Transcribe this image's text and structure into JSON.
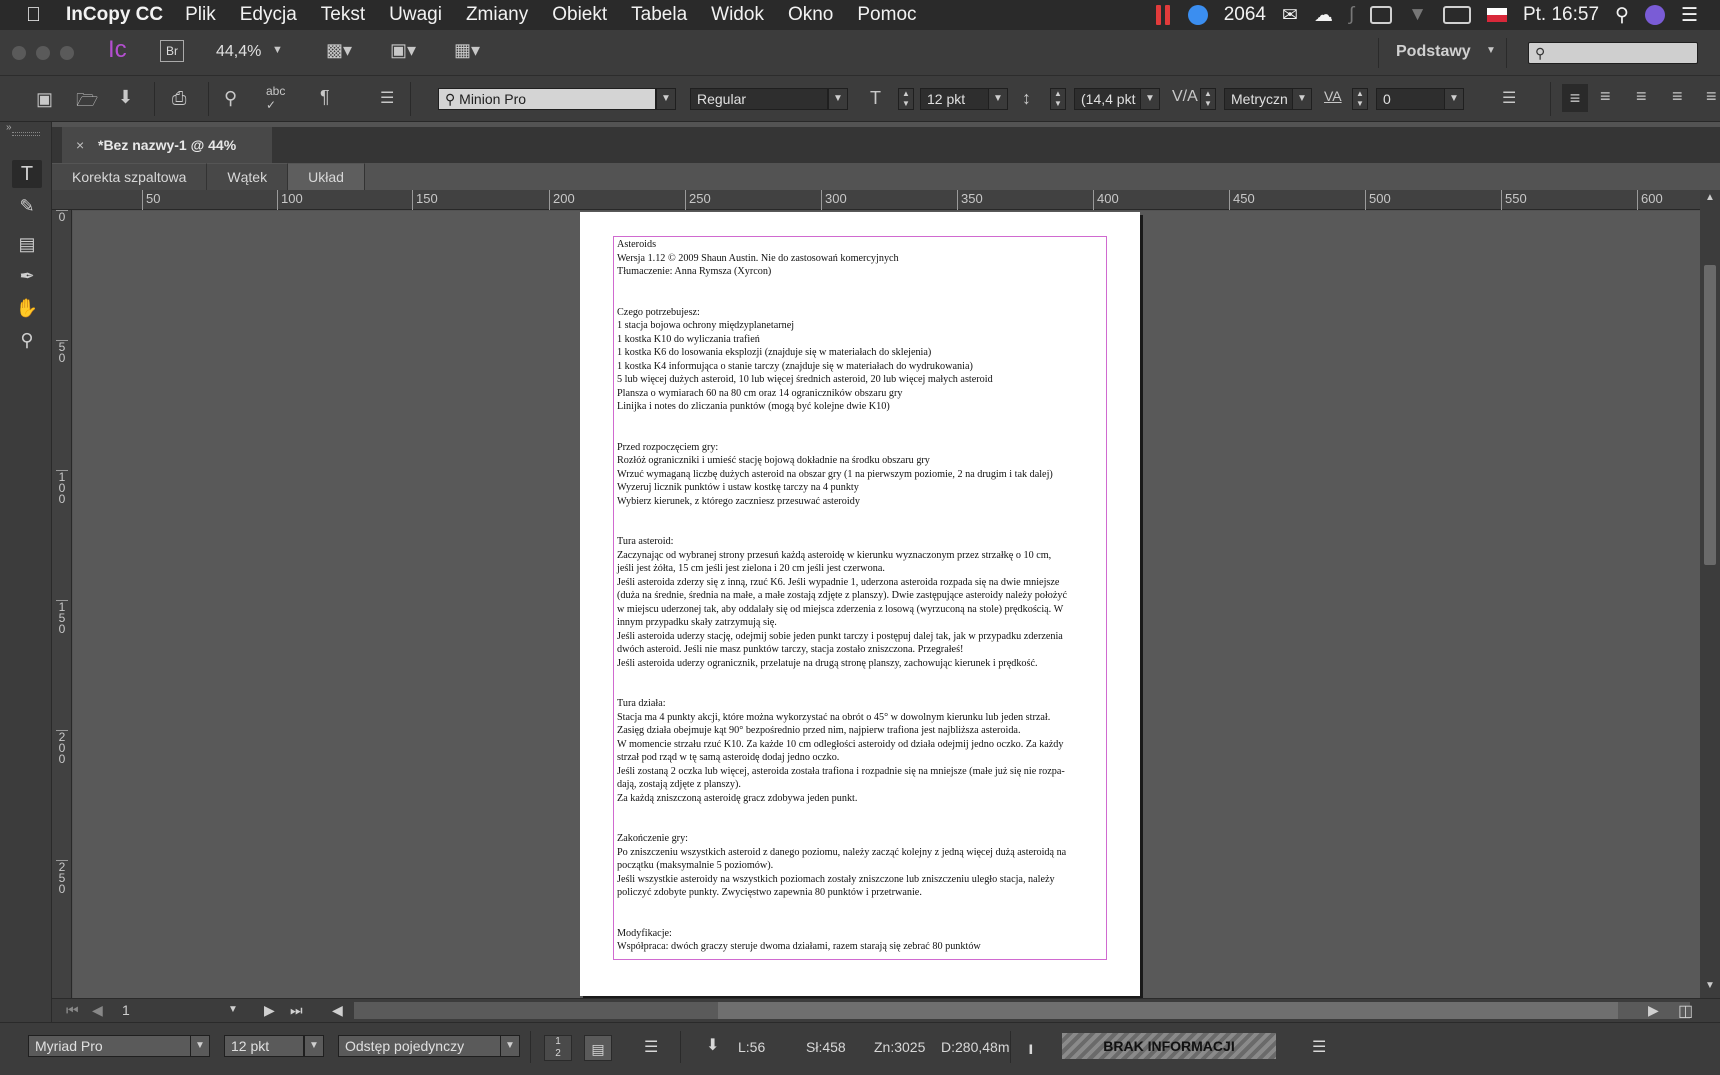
{
  "menubar": {
    "apple": "",
    "app": "InCopy CC",
    "items": [
      "Plik",
      "Edycja",
      "Tekst",
      "Uwagi",
      "Zmiany",
      "Obiekt",
      "Tabela",
      "Widok",
      "Okno",
      "Pomoc"
    ],
    "counter": "2064",
    "clock": "Pt. 16:57"
  },
  "appbar": {
    "app_icon": "Ic",
    "bridge": "Br",
    "zoom": "44,4%",
    "workspace": "Podstawy",
    "search_placeholder": ""
  },
  "toolbar": {
    "font_family": "Minion Pro",
    "font_style": "Regular",
    "font_size": "12 pkt",
    "leading": "(14,4 pkt",
    "kerning": "Metryczn",
    "tracking": "0"
  },
  "tab": {
    "close": "×",
    "title": "*Bez nazwy-1 @ 44%"
  },
  "view_tabs": [
    "Korekta szpaltowa",
    "Wątek",
    "Układ"
  ],
  "ruler": {
    "h": [
      "50",
      "100",
      "150",
      "200",
      "250",
      "300",
      "350",
      "400",
      "450",
      "500",
      "550",
      "600"
    ],
    "v": [
      "0",
      "50",
      "100",
      "150",
      "200",
      "250"
    ]
  },
  "story": {
    "blocks": [
      [
        "Asteroids",
        "Wersja 1.12 © 2009 Shaun Austin. Nie do zastosowań komercyjnych",
        "Tłumaczenie: Anna Rymsza (Xyrcon)"
      ],
      [
        "Czego potrzebujesz:",
        "1 stacja bojowa ochrony międzyplanetarnej",
        "1 kostka K10 do wyliczania trafień",
        "1 kostka K6 do losowania eksplozji (znajduje się w materiałach do sklejenia)",
        "1 kostka K4 informująca o stanie tarczy (znajduje się w materiałach do wydrukowania)",
        "5 lub więcej dużych asteroid, 10 lub więcej średnich asteroid, 20 lub więcej małych asteroid",
        "Plansza o wymiarach 60 na 80 cm oraz 14 ograniczników obszaru gry",
        "Linijka i notes do zliczania punktów (mogą być kolejne dwie K10)"
      ],
      [
        "Przed rozpoczęciem gry:",
        "Rozłóż ograniczniki i umieść stację bojową dokładnie na środku obszaru gry",
        "Wrzuć wymaganą liczbę dużych asteroid na obszar gry (1 na pierwszym poziomie, 2 na drugim i tak dalej)",
        "Wyzeruj licznik punktów i ustaw kostkę tarczy na 4 punkty",
        "Wybierz kierunek, z którego zaczniesz przesuwać asteroidy"
      ],
      [
        "Tura asteroid:",
        "Zaczynając od wybranej strony przesuń każdą asteroidę w kierunku wyznaczonym przez strzałkę o 10 cm,",
        "jeśli jest żółta, 15 cm jeśli jest zielona i 20 cm jeśli jest czerwona.",
        "Jeśli asteroida zderzy się z inną, rzuć K6. Jeśli wypadnie 1, uderzona asteroida rozpada się na dwie mniejsze",
        "(duża na średnie, średnia na małe, a małe zostają zdjęte z planszy). Dwie zastępujące asteroidy należy położyć",
        "w miejscu uderzonej tak, aby oddalały się od miejsca zderzenia z losową (wyrzuconą na stole) prędkością. W",
        "innym przypadku skały zatrzymują się.",
        "Jeśli asteroida uderzy stację, odejmij sobie jeden punkt tarczy i postępuj dalej tak, jak w przypadku zderzenia",
        "dwóch asteroid. Jeśli nie masz punktów tarczy, stacja zostało zniszczona. Przegrałeś!",
        "Jeśli asteroida uderzy ogranicznik, przelatuje na drugą stronę planszy, zachowując kierunek i prędkość."
      ],
      [
        "Tura działa:",
        "Stacja ma 4 punkty akcji, które można wykorzystać na obrót o 45° w dowolnym kierunku lub jeden strzał.",
        "Zasięg działa obejmuje kąt 90° bezpośrednio przed nim, najpierw trafiona jest najbliższa asteroida.",
        "W momencie strzału rzuć K10. Za każde 10 cm odległości asteroidy od działa odejmij jedno oczko. Za każdy",
        "strzał pod rząd w tę samą asteroidę dodaj jedno oczko.",
        "Jeśli zostaną 2 oczka lub więcej, asteroida została trafiona i rozpadnie się na mniejsze (małe już się nie rozpa-",
        "dają, zostają zdjęte z planszy).",
        "Za każdą zniszczoną asteroidę gracz zdobywa jeden punkt."
      ],
      [
        "Zakończenie gry:",
        "Po zniszczeniu wszystkich asteroid z danego poziomu, należy zacząć kolejny z jedną więcej dużą asteroidą na",
        "początku (maksymalnie 5 poziomów).",
        "Jeśli wszystkie asteroidy na wszystkich poziomach zostały zniszczone lub zniszczeniu uległo stacja, należy",
        "policzyć zdobyte punkty. Zwycięstwo zapewnia 80 punktów i przetrwanie."
      ],
      [
        "Modyfikacje:",
        "Współpraca: dwóch graczy steruje dwoma działami, razem starają się zebrać 80 punktów"
      ]
    ]
  },
  "pagenav": {
    "page": "1"
  },
  "statusbar": {
    "font": "Myriad Pro",
    "size": "12 pkt",
    "spacing": "Odstęp pojedynczy",
    "lines": "L:56",
    "words": "Sł:458",
    "chars": "Zn:3025",
    "depth": "D:280,48m",
    "info": "BRAK INFORMACJI"
  }
}
